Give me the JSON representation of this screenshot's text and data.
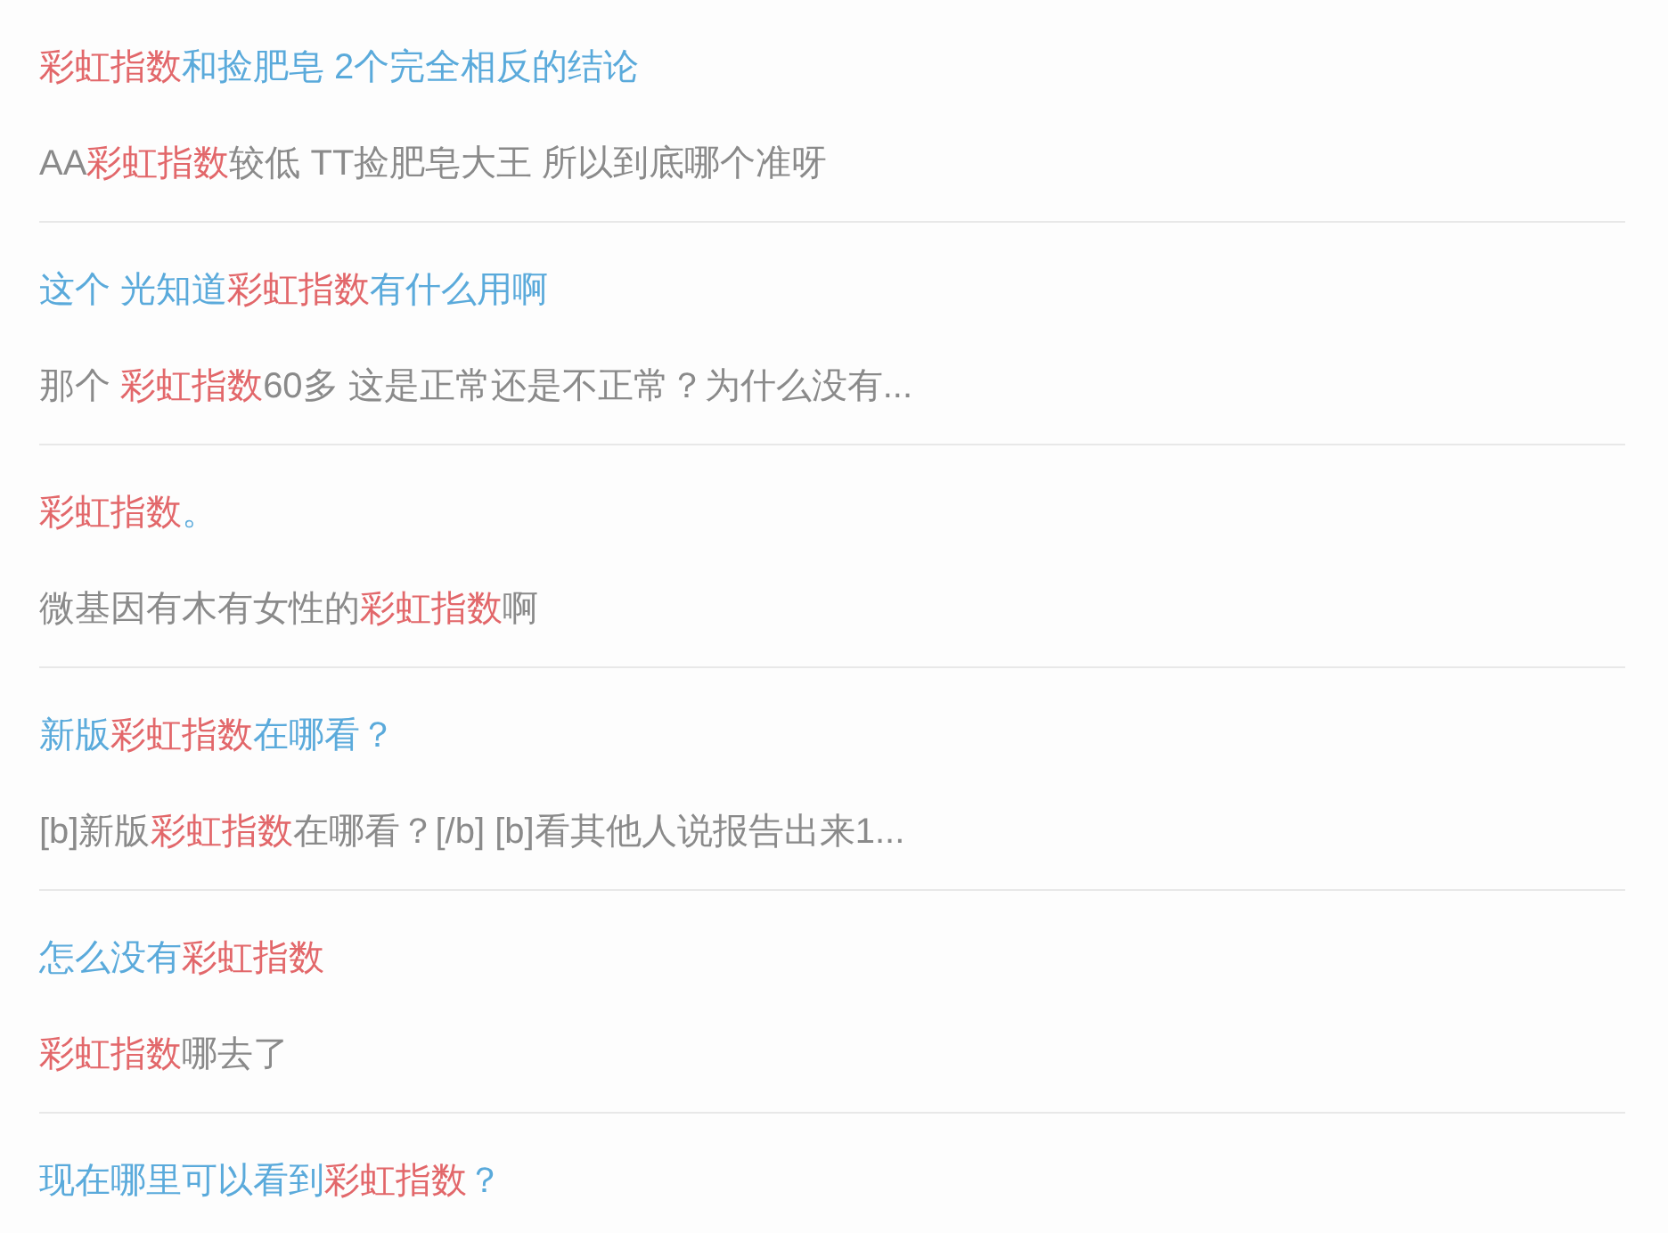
{
  "results": [
    {
      "title": [
        {
          "text": "彩虹指数",
          "highlight": true
        },
        {
          "text": "和捡肥皂 2个完全相反的结论",
          "highlight": false
        }
      ],
      "snippet": [
        {
          "text": "AA",
          "highlight": false
        },
        {
          "text": "彩虹指数",
          "highlight": true
        },
        {
          "text": "较低 TT捡肥皂大王 所以到底哪个准呀",
          "highlight": false
        }
      ]
    },
    {
      "title": [
        {
          "text": "这个 光知道",
          "highlight": false
        },
        {
          "text": "彩虹指数",
          "highlight": true
        },
        {
          "text": "有什么用啊",
          "highlight": false
        }
      ],
      "snippet": [
        {
          "text": "那个 ",
          "highlight": false
        },
        {
          "text": "彩虹指数",
          "highlight": true
        },
        {
          "text": "60多 这是正常还是不正常？为什么没有...",
          "highlight": false
        }
      ]
    },
    {
      "title": [
        {
          "text": "彩虹指数",
          "highlight": true
        },
        {
          "text": "。",
          "highlight": false
        }
      ],
      "snippet": [
        {
          "text": "微基因有木有女性的",
          "highlight": false
        },
        {
          "text": "彩虹指数",
          "highlight": true
        },
        {
          "text": "啊",
          "highlight": false
        }
      ]
    },
    {
      "title": [
        {
          "text": "新版",
          "highlight": false
        },
        {
          "text": "彩虹指数",
          "highlight": true
        },
        {
          "text": "在哪看？",
          "highlight": false
        }
      ],
      "snippet": [
        {
          "text": "[b]新版",
          "highlight": false
        },
        {
          "text": "彩虹指数",
          "highlight": true
        },
        {
          "text": "在哪看？[/b] [b]看其他人说报告出来1...",
          "highlight": false
        }
      ]
    },
    {
      "title": [
        {
          "text": "怎么没有",
          "highlight": false
        },
        {
          "text": "彩虹指数",
          "highlight": true
        }
      ],
      "snippet": [
        {
          "text": "彩虹指数",
          "highlight": true
        },
        {
          "text": "哪去了",
          "highlight": false
        }
      ]
    },
    {
      "title": [
        {
          "text": "现在哪里可以看到",
          "highlight": false
        },
        {
          "text": "彩虹指数",
          "highlight": true
        },
        {
          "text": "？",
          "highlight": false
        }
      ]
    }
  ]
}
